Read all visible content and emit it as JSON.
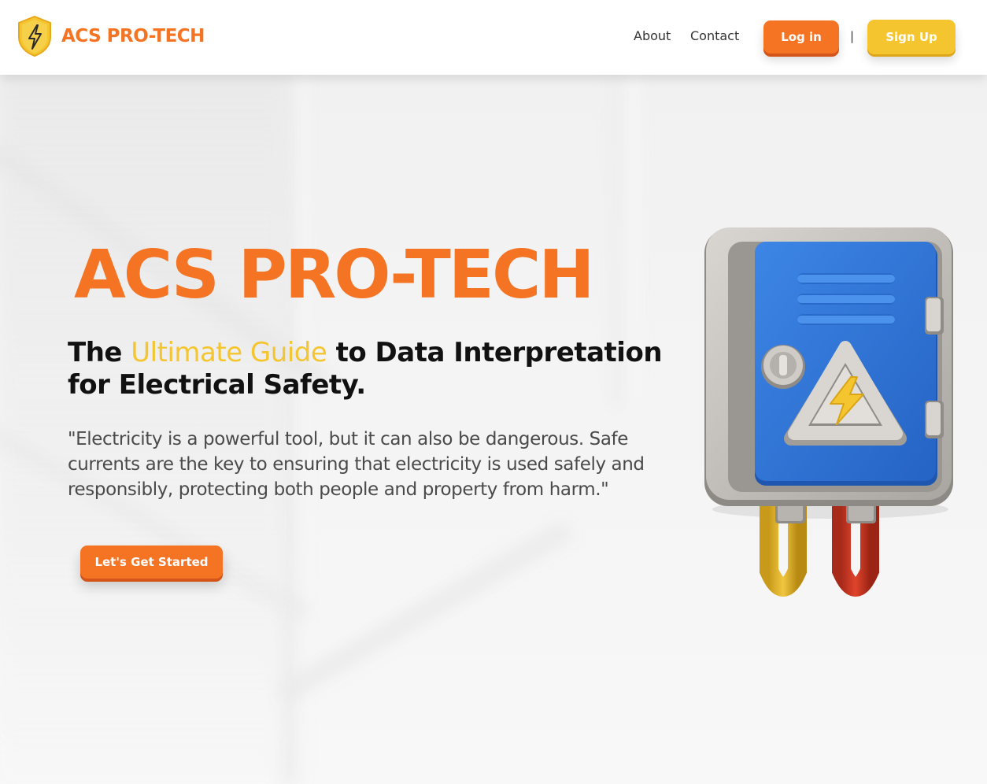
{
  "header": {
    "brand": "ACS PRO-TECH",
    "nav": {
      "about": "About",
      "contact": "Contact",
      "separator": "|"
    },
    "login_label": "Log in",
    "signup_label": "Sign Up"
  },
  "hero": {
    "title": "ACS PRO-TECH",
    "subtitle_prefix": "The ",
    "subtitle_highlight": "Ultimate Guide",
    "subtitle_suffix": " to Data Interpretation for Electrical Safety.",
    "quote": "\"Electricity is a powerful tool, but it can also be dangerous. Safe currents are the key to ensuring that electricity is used safely and responsibly, protecting both people and property from harm.\"",
    "cta_label": "Let's Get Started"
  },
  "icons": {
    "logo": "lightning-shield-icon",
    "illustration": "electrical-panel-illustration"
  },
  "colors": {
    "brand_orange": "#f47424",
    "accent_yellow": "#f5c52f",
    "panel_blue": "#2f76d6",
    "text_dark": "#111111"
  }
}
